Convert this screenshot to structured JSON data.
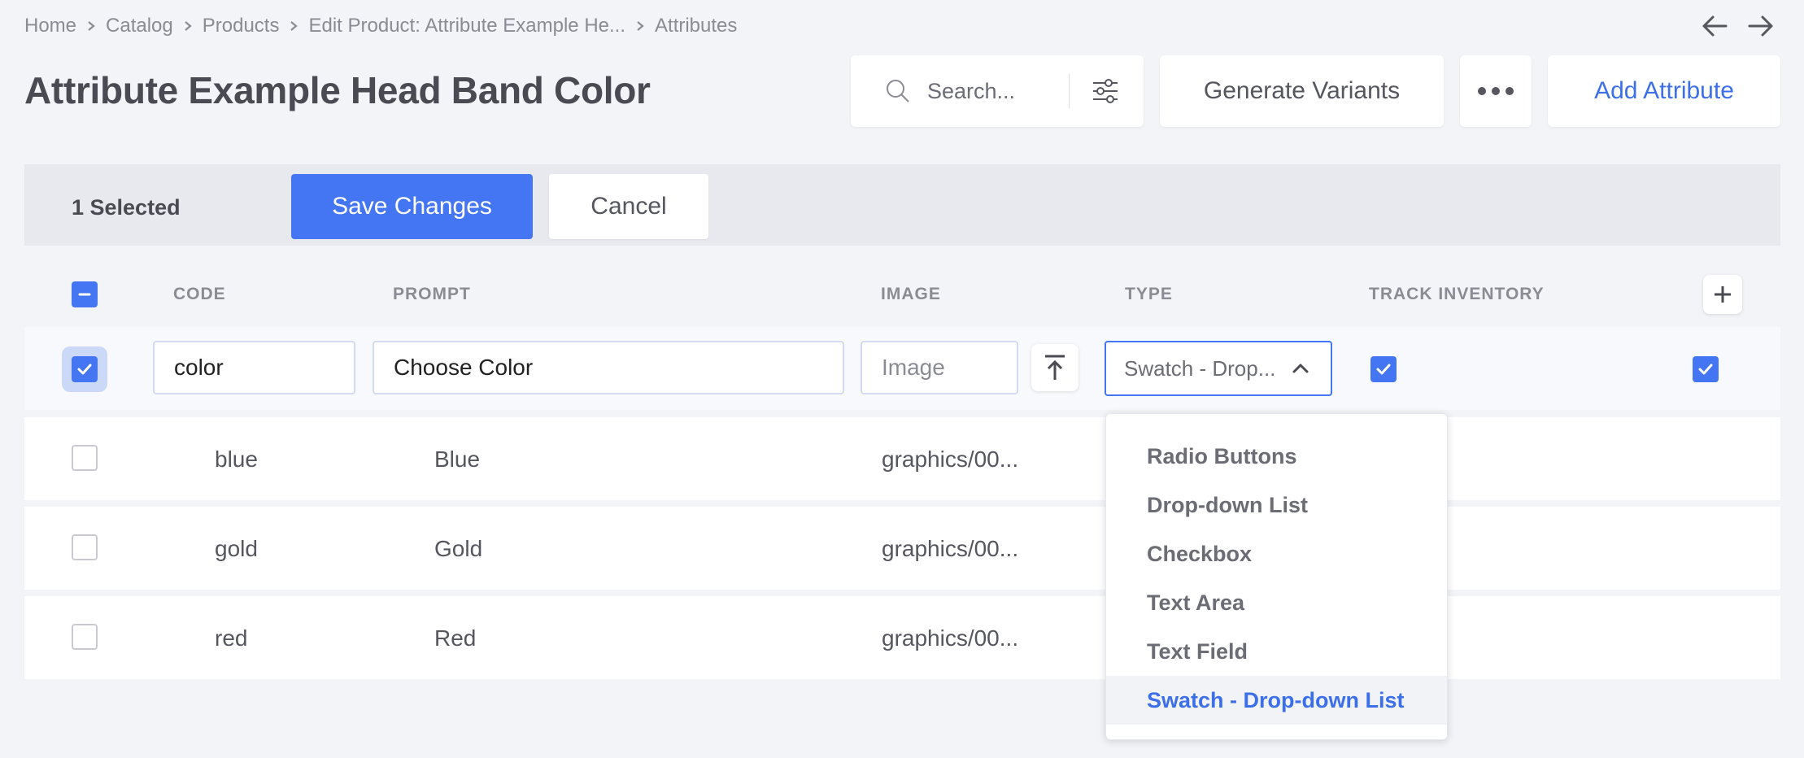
{
  "breadcrumb": [
    "Home",
    "Catalog",
    "Products",
    "Edit Product: Attribute Example He...",
    "Attributes"
  ],
  "page_title": "Attribute Example Head Band Color",
  "toolbar": {
    "search_placeholder": "Search...",
    "generate_label": "Generate Variants",
    "more_label": "•••",
    "add_label": "Add Attribute"
  },
  "selection": {
    "count_text": "1 Selected",
    "save_label": "Save Changes",
    "cancel_label": "Cancel"
  },
  "table": {
    "headers": {
      "code": "CODE",
      "prompt": "PROMPT",
      "image": "IMAGE",
      "type": "TYPE",
      "track": "TRACK INVENTORY"
    },
    "edit_row": {
      "code": "color",
      "prompt": "Choose Color",
      "image_placeholder": "Image",
      "type": "Swatch - Drop..."
    },
    "rows": [
      {
        "code": "blue",
        "prompt": "Blue",
        "image": "graphics/00..."
      },
      {
        "code": "gold",
        "prompt": "Gold",
        "image": "graphics/00..."
      },
      {
        "code": "red",
        "prompt": "Red",
        "image": "graphics/00..."
      }
    ]
  },
  "type_options": [
    "Radio Buttons",
    "Drop-down List",
    "Checkbox",
    "Text Area",
    "Text Field",
    "Swatch - Drop-down List"
  ],
  "selected_type": "Swatch - Drop-down List",
  "colors": {
    "accent": "#4475f2",
    "background": "#f3f4f8"
  },
  "icons": {
    "breadcrumb_sep": "chevron-right-icon",
    "back": "arrow-left-icon",
    "forward": "arrow-right-icon",
    "search": "search-icon",
    "filter": "sliders-icon",
    "add_column": "plus-icon",
    "upload": "upload-icon",
    "dropdown_open": "chevron-up-icon"
  }
}
